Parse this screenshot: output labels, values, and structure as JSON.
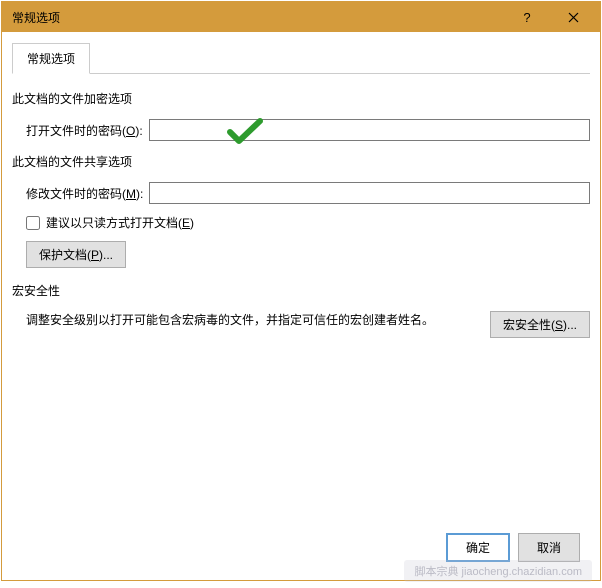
{
  "window": {
    "title": "常规选项"
  },
  "tab": {
    "label": "常规选项"
  },
  "sections": {
    "encrypt": {
      "heading": "此文档的文件加密选项",
      "open_pwd_label_pre": "打开文件时的密码(",
      "open_pwd_key": "O",
      "open_pwd_label_post": "):",
      "open_pwd_value": ""
    },
    "share": {
      "heading": "此文档的文件共享选项",
      "modify_pwd_label_pre": "修改文件时的密码(",
      "modify_pwd_key": "M",
      "modify_pwd_label_post": "):",
      "modify_pwd_value": "",
      "readonly_label_pre": "建议以只读方式打开文档(",
      "readonly_key": "E",
      "readonly_label_post": ")",
      "protect_btn_pre": "保护文档(",
      "protect_btn_key": "P",
      "protect_btn_post": ")..."
    },
    "macro": {
      "heading": "宏安全性",
      "text": "调整安全级别以打开可能包含宏病毒的文件，并指定可信任的宏创建者姓名。",
      "btn_pre": "宏安全性(",
      "btn_key": "S",
      "btn_post": ")..."
    }
  },
  "footer": {
    "ok": "确定",
    "cancel": "取消"
  },
  "watermark": "脚本宗典 jiaocheng.chazidian.com"
}
